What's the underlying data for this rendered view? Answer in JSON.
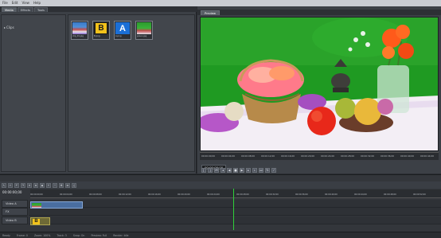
{
  "menu": [
    "File",
    "Edit",
    "View",
    "Help"
  ],
  "left_tabs": [
    "Media",
    "Effects",
    "Tools"
  ],
  "tree": {
    "root_label": "Clips"
  },
  "media_clips": [
    {
      "caption": "clip_01.jpg",
      "icon": "photo"
    },
    {
      "caption": "B.png",
      "icon": "letter-b"
    },
    {
      "caption": "A.png",
      "icon": "letter-a"
    },
    {
      "caption": "green.jpg",
      "icon": "green-photo"
    }
  ],
  "clip_letters": {
    "b": "B",
    "a": "A"
  },
  "preview": {
    "tab_label": "Preview",
    "timecode": "00:00:00;00",
    "ruler_ticks": [
      "00:00:00;00",
      "00:00:04;00",
      "00:00:08;00",
      "00:00:12;00",
      "00:00:16;00",
      "00:00:20;00",
      "00:00:24;00",
      "00:00:28;00",
      "00:00:32;00",
      "00:00:36;00",
      "00:00:40;00",
      "00:00:44;00"
    ]
  },
  "timeline": {
    "timecode": "00:00:00;00",
    "ruler_ticks": [
      "00:00:00;00",
      "00:00:04;00",
      "00:00:08;00",
      "00:00:12;00",
      "00:00:16;00",
      "00:00:20;00",
      "00:00:24;00",
      "00:00:28;00",
      "00:00:32;00",
      "00:00:36;00",
      "00:00:40;00",
      "00:00:44;00",
      "00:00:48;00",
      "00:00:52;00"
    ],
    "tracks": [
      {
        "label": "Video A"
      },
      {
        "label": "FX"
      },
      {
        "label": "Video B"
      }
    ],
    "clip_b_letter": "B"
  },
  "status": [
    "Ready",
    "Frame: 0",
    "Zoom: 100%",
    "Track: 3",
    "Snap: On",
    "Preview: Full",
    "Render: Idle"
  ]
}
